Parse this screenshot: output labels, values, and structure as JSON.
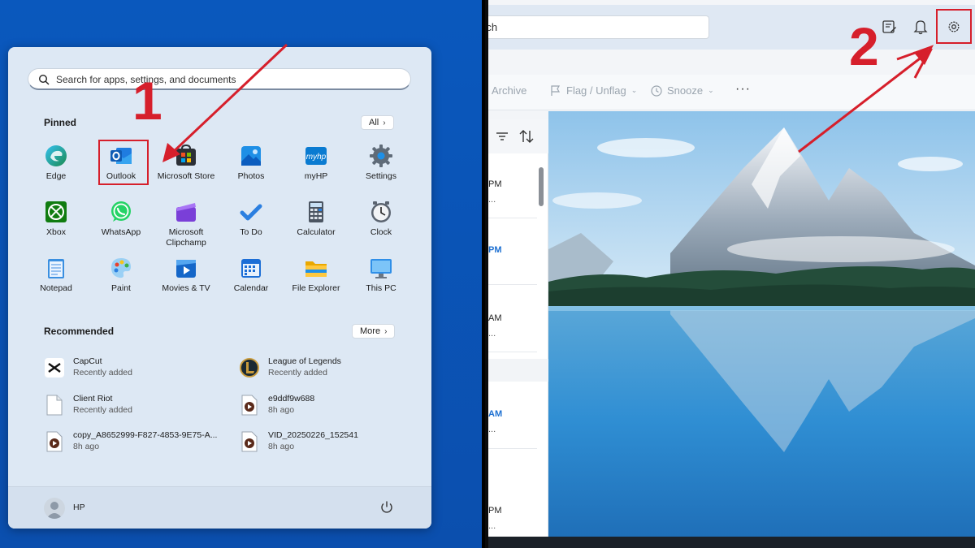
{
  "start_menu": {
    "search_placeholder": "Search for apps, settings, and documents",
    "pinned_title": "Pinned",
    "all_label": "All",
    "pinned_apps": [
      {
        "label": "Edge",
        "icon": "edge-icon"
      },
      {
        "label": "Outlook",
        "icon": "outlook-icon"
      },
      {
        "label": "Microsoft Store",
        "icon": "store-icon"
      },
      {
        "label": "Photos",
        "icon": "photos-icon"
      },
      {
        "label": "myHP",
        "icon": "myhp-icon"
      },
      {
        "label": "Settings",
        "icon": "settings-gear-icon"
      },
      {
        "label": "Xbox",
        "icon": "xbox-icon"
      },
      {
        "label": "WhatsApp",
        "icon": "whatsapp-icon"
      },
      {
        "label": "Microsoft Clipchamp",
        "icon": "clipchamp-icon"
      },
      {
        "label": "To Do",
        "icon": "todo-icon"
      },
      {
        "label": "Calculator",
        "icon": "calculator-icon"
      },
      {
        "label": "Clock",
        "icon": "clock-icon"
      },
      {
        "label": "Notepad",
        "icon": "notepad-icon"
      },
      {
        "label": "Paint",
        "icon": "paint-icon"
      },
      {
        "label": "Movies & TV",
        "icon": "movies-icon"
      },
      {
        "label": "Calendar",
        "icon": "calendar-icon"
      },
      {
        "label": "File Explorer",
        "icon": "folder-icon"
      },
      {
        "label": "This PC",
        "icon": "monitor-icon"
      }
    ],
    "recommended_title": "Recommended",
    "more_label": "More",
    "recommended": [
      {
        "name": "CapCut",
        "sub": "Recently added",
        "icon": "capcut-icon"
      },
      {
        "name": "League of Legends",
        "sub": "Recently added",
        "icon": "league-icon"
      },
      {
        "name": "Client Riot",
        "sub": "Recently added",
        "icon": "file-icon"
      },
      {
        "name": "e9ddf9w688",
        "sub": "8h ago",
        "icon": "video-file-icon"
      },
      {
        "name": "copy_A8652999-F827-4853-9E75-A...",
        "sub": "8h ago",
        "icon": "video-file-icon"
      },
      {
        "name": "VID_20250226_152541",
        "sub": "8h ago",
        "icon": "video-file-icon"
      }
    ],
    "user": "HP"
  },
  "annotations": {
    "step1": "1",
    "step2": "2",
    "color": "#d61f2b"
  },
  "outlook": {
    "search_text": "rch",
    "toolbar": {
      "archive": "Archive",
      "flag": "Flag / Unflag",
      "snooze": "Snooze",
      "more": "···"
    },
    "list_times": [
      {
        "time": "PM",
        "dots": "...",
        "blue": false
      },
      {
        "time": "PM",
        "dots": "",
        "blue": true
      },
      {
        "time": "AM",
        "dots": "...",
        "blue": false
      },
      {
        "time": "AM",
        "dots": "...",
        "blue": true
      },
      {
        "time": "PM",
        "dots": "...",
        "blue": false
      }
    ]
  }
}
